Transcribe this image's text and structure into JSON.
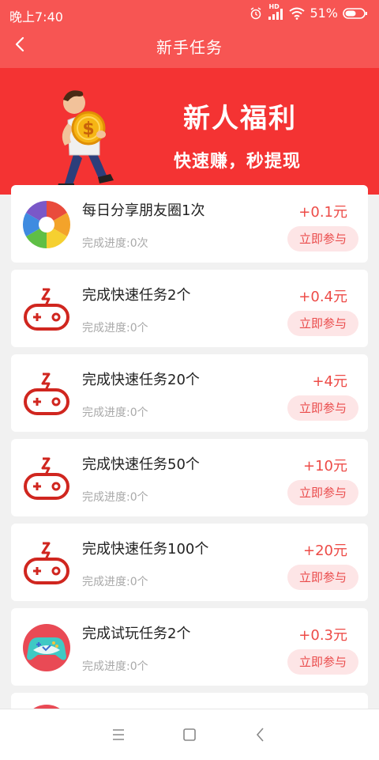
{
  "status": {
    "time": "晚上7:40",
    "hd": "HD",
    "battery": "51%"
  },
  "header": {
    "title": "新手任务"
  },
  "banner": {
    "title": "新人福利",
    "subtitle": "快速赚，秒提现"
  },
  "colors": {
    "primary": "#f75553",
    "banner": "#f43333",
    "accent": "#ed4b47",
    "button_bg": "#fde5e6"
  },
  "tasks": [
    {
      "icon": "aperture-icon",
      "name": "每日分享朋友圈1次",
      "progress": "完成进度:0次",
      "reward": "+0.1元",
      "action": "立即参与"
    },
    {
      "icon": "gamepad-icon",
      "name": "完成快速任务2个",
      "progress": "完成进度:0个",
      "reward": "+0.4元",
      "action": "立即参与"
    },
    {
      "icon": "gamepad-icon",
      "name": "完成快速任务20个",
      "progress": "完成进度:0个",
      "reward": "+4元",
      "action": "立即参与"
    },
    {
      "icon": "gamepad-icon",
      "name": "完成快速任务50个",
      "progress": "完成进度:0个",
      "reward": "+10元",
      "action": "立即参与"
    },
    {
      "icon": "gamepad-icon",
      "name": "完成快速任务100个",
      "progress": "完成进度:0个",
      "reward": "+20元",
      "action": "立即参与"
    },
    {
      "icon": "trial-game-icon",
      "name": "完成试玩任务2个",
      "progress": "完成进度:0个",
      "reward": "+0.3元",
      "action": "立即参与"
    }
  ],
  "navbar": {
    "icons": [
      "menu-icon",
      "home-icon",
      "back-icon"
    ]
  }
}
